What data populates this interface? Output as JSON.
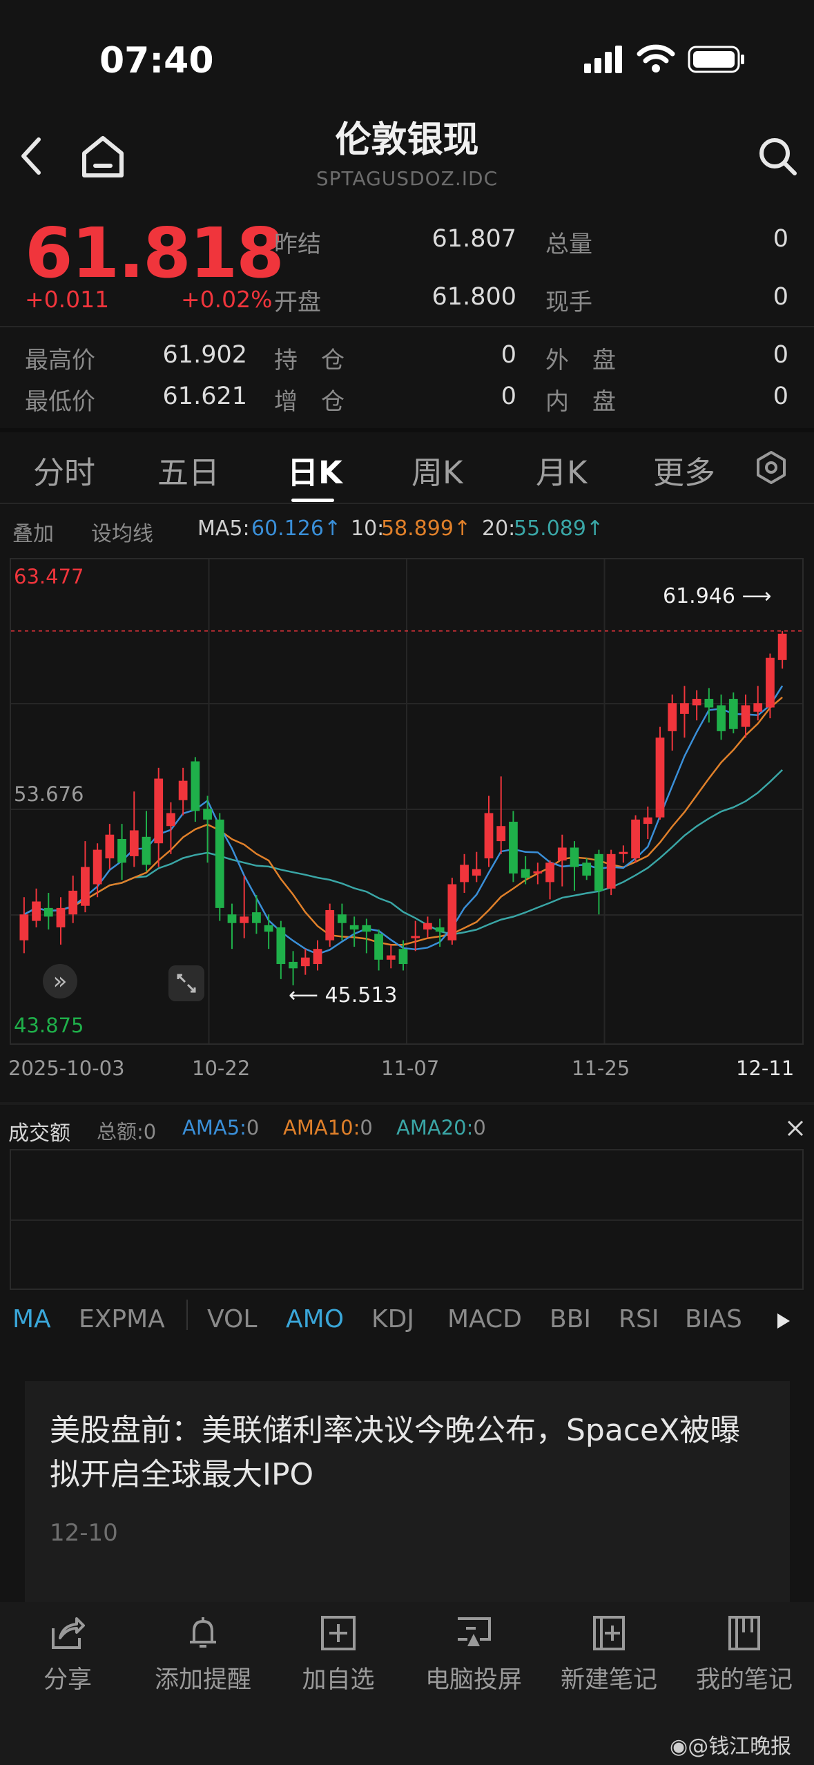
{
  "status": {
    "time": "07:40"
  },
  "header": {
    "title": "伦敦银现",
    "code": "SPTAGUSDOZ.IDC"
  },
  "quote": {
    "price": "61.818",
    "change": "+0.011",
    "change_pct": "+0.02%",
    "fields": [
      {
        "label": "昨结",
        "value": "61.807"
      },
      {
        "label": "开盘",
        "value": "61.800"
      },
      {
        "label": "总量",
        "value": "0"
      },
      {
        "label": "现手",
        "value": "0"
      },
      {
        "label": "最高价",
        "value": "61.902"
      },
      {
        "label": "最低价",
        "value": "61.621"
      },
      {
        "label": "持　仓",
        "value": "0"
      },
      {
        "label": "增　仓",
        "value": "0"
      },
      {
        "label": "外　盘",
        "value": "0"
      },
      {
        "label": "内　盘",
        "value": "0"
      }
    ]
  },
  "tabs": [
    "分时",
    "五日",
    "日K",
    "周K",
    "月K",
    "更多"
  ],
  "active_tab": "日K",
  "indicators": {
    "overlay": "叠加",
    "set_ma": "设均线",
    "ma5_label": "MA5:",
    "ma5": "60.126↑",
    "ma10_label": "10:",
    "ma10": "58.899↑",
    "ma20_label": "20:",
    "ma20": "55.089↑"
  },
  "colors": {
    "up": "#f0353c",
    "down": "#1fb04a",
    "ma5": "#3a8fd8",
    "ma10": "#e0802a",
    "ma20": "#3aa6a6"
  },
  "chart_data": {
    "type": "candlestick",
    "y_labels": {
      "top": "63.477",
      "mid": "53.676",
      "bottom": "43.875"
    },
    "ylim": [
      43.875,
      63.477
    ],
    "x_ticks": [
      "2025-10-03",
      "10-22",
      "11-07",
      "11-25",
      "12-11"
    ],
    "annotations": {
      "high": "61.946",
      "low": "45.513"
    },
    "candles": [
      {
        "o": 47.6,
        "c": 48.8,
        "h": 49.6,
        "l": 47.0
      },
      {
        "o": 48.5,
        "c": 49.4,
        "h": 50.0,
        "l": 48.2
      },
      {
        "o": 49.1,
        "c": 48.7,
        "h": 49.8,
        "l": 48.1
      },
      {
        "o": 48.2,
        "c": 49.1,
        "h": 49.6,
        "l": 47.4
      },
      {
        "o": 48.8,
        "c": 49.9,
        "h": 50.6,
        "l": 48.4
      },
      {
        "o": 49.2,
        "c": 51.0,
        "h": 52.2,
        "l": 48.9
      },
      {
        "o": 50.2,
        "c": 51.8,
        "h": 52.1,
        "l": 49.6
      },
      {
        "o": 51.4,
        "c": 52.5,
        "h": 53.0,
        "l": 50.9
      },
      {
        "o": 52.3,
        "c": 51.2,
        "h": 53.0,
        "l": 50.4
      },
      {
        "o": 51.5,
        "c": 52.7,
        "h": 54.5,
        "l": 51.0
      },
      {
        "o": 52.4,
        "c": 51.1,
        "h": 53.6,
        "l": 50.8
      },
      {
        "o": 52.1,
        "c": 55.1,
        "h": 55.6,
        "l": 51.0
      },
      {
        "o": 52.9,
        "c": 53.5,
        "h": 54.0,
        "l": 51.6
      },
      {
        "o": 54.1,
        "c": 55.0,
        "h": 55.6,
        "l": 53.4
      },
      {
        "o": 55.9,
        "c": 53.6,
        "h": 56.1,
        "l": 53.1
      },
      {
        "o": 53.7,
        "c": 53.2,
        "h": 54.3,
        "l": 51.2
      },
      {
        "o": 53.2,
        "c": 49.1,
        "h": 53.5,
        "l": 48.5
      },
      {
        "o": 48.8,
        "c": 48.4,
        "h": 49.3,
        "l": 47.2
      },
      {
        "o": 48.4,
        "c": 48.7,
        "h": 50.6,
        "l": 47.7
      },
      {
        "o": 48.9,
        "c": 48.4,
        "h": 49.7,
        "l": 47.9
      },
      {
        "o": 48.3,
        "c": 48.0,
        "h": 48.8,
        "l": 47.2
      },
      {
        "o": 48.2,
        "c": 46.5,
        "h": 48.5,
        "l": 45.8
      },
      {
        "o": 46.6,
        "c": 46.3,
        "h": 47.1,
        "l": 45.513
      },
      {
        "o": 46.4,
        "c": 46.8,
        "h": 47.2,
        "l": 46.0
      },
      {
        "o": 46.5,
        "c": 47.2,
        "h": 47.6,
        "l": 46.2
      },
      {
        "o": 47.6,
        "c": 49.0,
        "h": 49.3,
        "l": 47.3
      },
      {
        "o": 48.8,
        "c": 48.4,
        "h": 49.3,
        "l": 47.6
      },
      {
        "o": 48.3,
        "c": 48.1,
        "h": 48.7,
        "l": 47.3
      },
      {
        "o": 48.3,
        "c": 48.0,
        "h": 48.6,
        "l": 47.0
      },
      {
        "o": 47.9,
        "c": 46.7,
        "h": 48.1,
        "l": 46.2
      },
      {
        "o": 46.7,
        "c": 46.9,
        "h": 47.4,
        "l": 46.3
      },
      {
        "o": 47.2,
        "c": 46.5,
        "h": 47.6,
        "l": 46.2
      },
      {
        "o": 47.7,
        "c": 47.8,
        "h": 48.5,
        "l": 47.1
      },
      {
        "o": 48.1,
        "c": 48.4,
        "h": 48.7,
        "l": 47.7
      },
      {
        "o": 48.2,
        "c": 48.0,
        "h": 48.6,
        "l": 47.3
      },
      {
        "o": 47.6,
        "c": 50.2,
        "h": 50.5,
        "l": 47.4
      },
      {
        "o": 50.3,
        "c": 51.1,
        "h": 51.6,
        "l": 49.8
      },
      {
        "o": 50.6,
        "c": 50.9,
        "h": 51.7,
        "l": 50.3
      },
      {
        "o": 51.4,
        "c": 53.5,
        "h": 54.3,
        "l": 51.0
      },
      {
        "o": 52.2,
        "c": 52.9,
        "h": 55.2,
        "l": 51.6
      },
      {
        "o": 53.1,
        "c": 50.7,
        "h": 53.6,
        "l": 50.3
      },
      {
        "o": 50.9,
        "c": 50.5,
        "h": 51.5,
        "l": 50.2
      },
      {
        "o": 50.7,
        "c": 50.8,
        "h": 51.2,
        "l": 50.2
      },
      {
        "o": 50.3,
        "c": 51.2,
        "h": 51.3,
        "l": 49.5
      },
      {
        "o": 51.3,
        "c": 51.9,
        "h": 52.5,
        "l": 50.1
      },
      {
        "o": 51.9,
        "c": 51.0,
        "h": 52.2,
        "l": 49.9
      },
      {
        "o": 51.2,
        "c": 50.6,
        "h": 51.4,
        "l": 50.4
      },
      {
        "o": 51.6,
        "c": 49.9,
        "h": 51.8,
        "l": 48.8
      },
      {
        "o": 50.0,
        "c": 51.6,
        "h": 51.8,
        "l": 49.7
      },
      {
        "o": 51.6,
        "c": 51.7,
        "h": 52.0,
        "l": 51.2
      },
      {
        "o": 51.4,
        "c": 53.2,
        "h": 53.4,
        "l": 51.2
      },
      {
        "o": 53.0,
        "c": 53.3,
        "h": 53.8,
        "l": 52.3
      },
      {
        "o": 53.3,
        "c": 57.0,
        "h": 57.5,
        "l": 53.2
      },
      {
        "o": 57.3,
        "c": 58.6,
        "h": 59.0,
        "l": 56.4
      },
      {
        "o": 58.1,
        "c": 58.6,
        "h": 59.4,
        "l": 57.0
      },
      {
        "o": 58.5,
        "c": 58.8,
        "h": 59.2,
        "l": 57.8
      },
      {
        "o": 58.8,
        "c": 58.4,
        "h": 59.3,
        "l": 57.7
      },
      {
        "o": 58.5,
        "c": 57.3,
        "h": 59.0,
        "l": 56.9
      },
      {
        "o": 58.8,
        "c": 57.4,
        "h": 59.1,
        "l": 57.2
      },
      {
        "o": 57.5,
        "c": 58.5,
        "h": 59.0,
        "l": 57.0
      },
      {
        "o": 58.2,
        "c": 58.6,
        "h": 59.4,
        "l": 57.8
      },
      {
        "o": 58.4,
        "c": 60.7,
        "h": 60.9,
        "l": 57.9
      },
      {
        "o": 60.6,
        "c": 61.818,
        "h": 61.946,
        "l": 60.2
      }
    ]
  },
  "volume": {
    "title": "成交额",
    "total": "总额:0",
    "ama5_label": "AMA5:",
    "ama5": "0",
    "ama10_label": "AMA10:",
    "ama10": "0",
    "ama20_label": "AMA20:",
    "ama20": "0"
  },
  "bottom_tabs": [
    "MA",
    "EXPMA",
    "VOL",
    "AMO",
    "KDJ",
    "MACD",
    "BBI",
    "RSI",
    "BIAS"
  ],
  "news": {
    "headline": "美股盘前：美联储利率决议今晚公布，SpaceX被曝拟开启全球最大IPO",
    "date": "12-10"
  },
  "toolbar": [
    {
      "label": "分享",
      "icon": "share-icon"
    },
    {
      "label": "添加提醒",
      "icon": "bell-icon"
    },
    {
      "label": "加自选",
      "icon": "add-watchlist-icon"
    },
    {
      "label": "电脑投屏",
      "icon": "screen-cast-icon"
    },
    {
      "label": "新建笔记",
      "icon": "new-note-icon"
    },
    {
      "label": "我的笔记",
      "icon": "notebook-icon"
    }
  ],
  "watermark": "@钱江晚报"
}
